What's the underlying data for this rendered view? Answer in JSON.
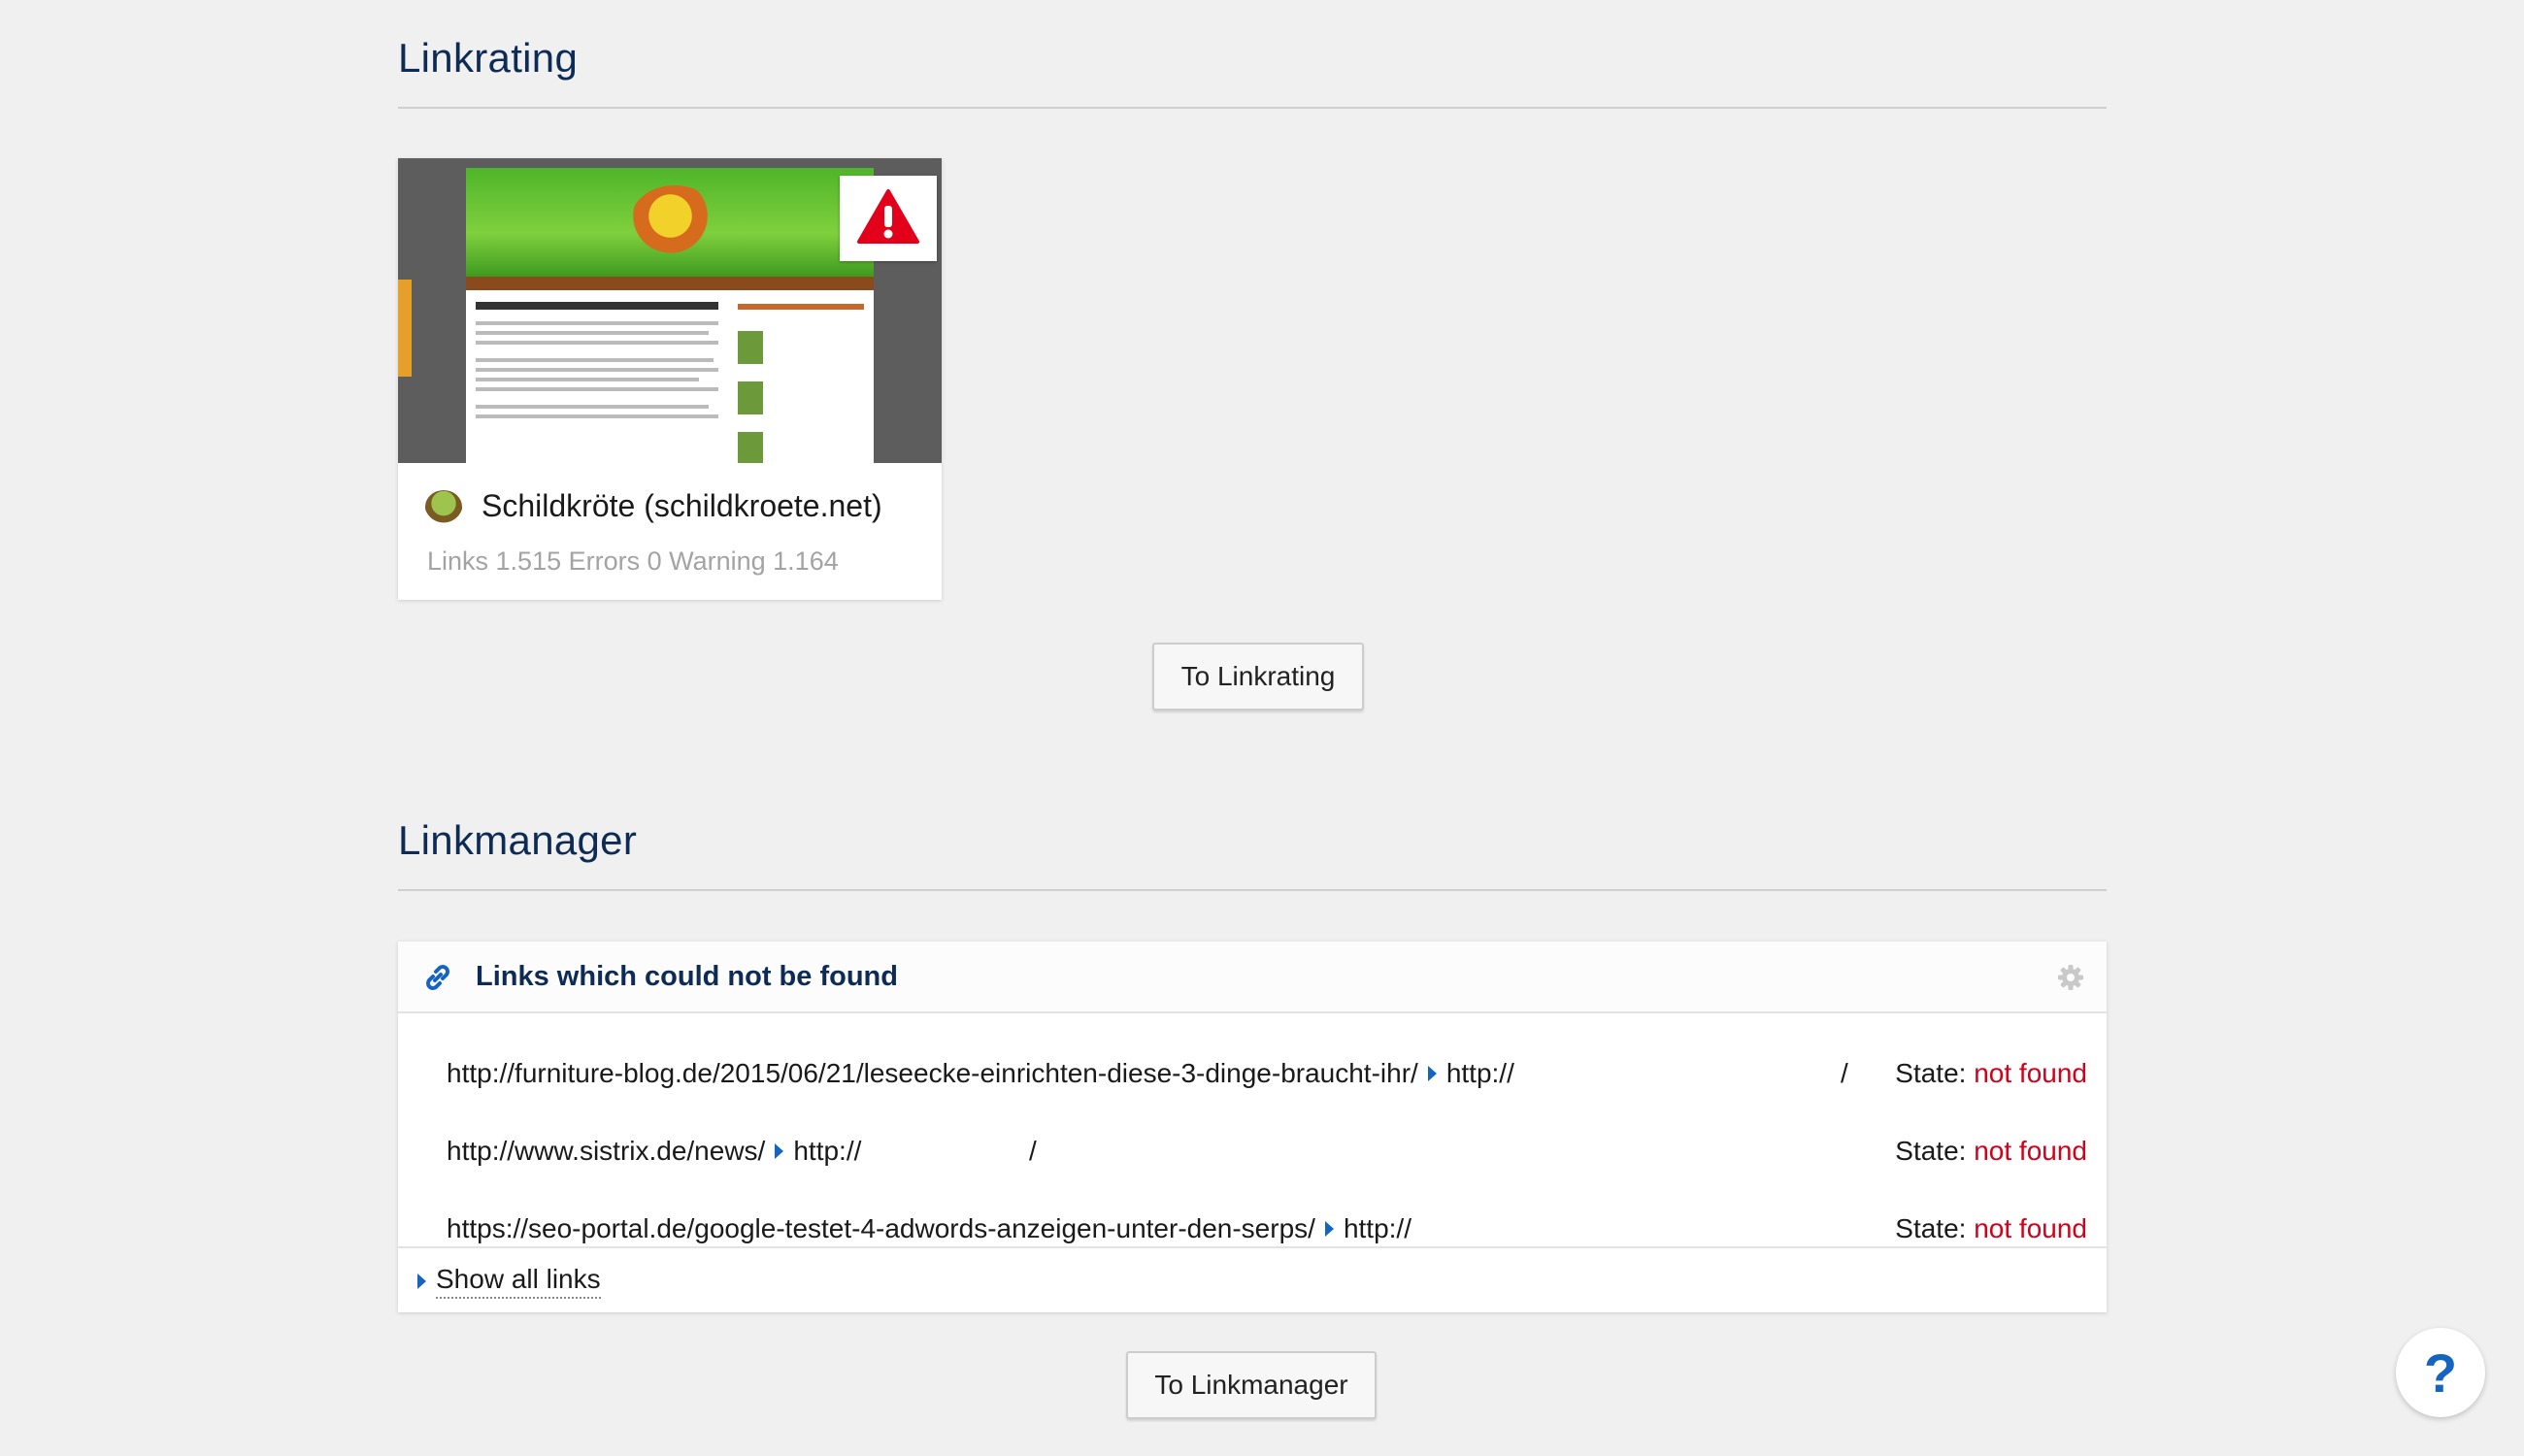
{
  "linkrating": {
    "title": "Linkrating",
    "card": {
      "site_name": "Schildkröte (schildkroete.net)",
      "stats": "Links 1.515 Errors 0 Warning 1.164",
      "warning_icon": "warning-triangle-icon"
    },
    "button_label": "To Linkrating"
  },
  "linkmanager": {
    "title": "Linkmanager",
    "panel_title": "Links which could not be found",
    "rows": [
      {
        "source": "http://furniture-blog.de/2015/06/21/leseecke-einrichten-diese-3-dinge-braucht-ihr/",
        "target": "http://",
        "target_tail": "/",
        "state_label": "State:",
        "state_value": "not found"
      },
      {
        "source": "http://www.sistrix.de/news/",
        "target": "http://",
        "target_tail": "/",
        "state_label": "State:",
        "state_value": "not found"
      },
      {
        "source": "https://seo-portal.de/google-testet-4-adwords-anzeigen-unter-den-serps/",
        "target": "http://",
        "target_tail": "",
        "state_label": "State:",
        "state_value": "not found"
      }
    ],
    "show_all_label": "Show all links",
    "button_label": "To Linkmanager"
  },
  "help": {
    "label": "?"
  },
  "colors": {
    "heading": "#0d2b55",
    "accent": "#1565c0",
    "error": "#d0021b"
  }
}
